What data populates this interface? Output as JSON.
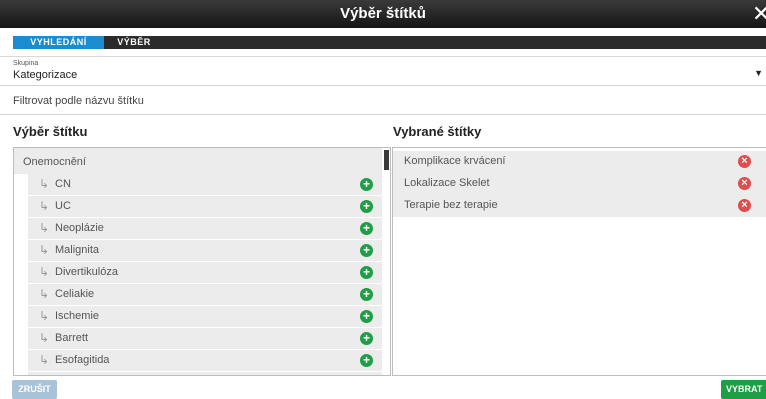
{
  "dialog": {
    "title": "Výběr štítků",
    "close_icon": "close-icon"
  },
  "tabs": [
    {
      "label": "VYHLEDÁNÍ",
      "active": true
    },
    {
      "label": "VÝBĚR",
      "active": false
    }
  ],
  "group": {
    "label": "Skupina",
    "value": "Kategorizace"
  },
  "filter": {
    "placeholder": "Filtrovat podle názvu štítku",
    "value": ""
  },
  "left": {
    "heading": "Výběr štítku",
    "parent": "Onemocnění",
    "children": [
      {
        "label": "CN"
      },
      {
        "label": "UC"
      },
      {
        "label": "Neoplázie"
      },
      {
        "label": "Malignita"
      },
      {
        "label": "Divertikulóza"
      },
      {
        "label": "Celiakie"
      },
      {
        "label": "Ischemie"
      },
      {
        "label": "Barrett"
      },
      {
        "label": "Esofagitida"
      },
      {
        "label": ""
      }
    ]
  },
  "right": {
    "heading": "Vybrané štítky",
    "selected": [
      {
        "label": "Komplikace krvácení"
      },
      {
        "label": "Lokalizace Skelet"
      },
      {
        "label": "Terapie bez terapie"
      }
    ]
  },
  "buttons": {
    "cancel": "ZRUŠIT",
    "select": "VYBRAT"
  },
  "colors": {
    "tab_active": "#1b8ccd",
    "add": "#1e9e45",
    "remove": "#e14c4c",
    "select_button": "#1e9e45",
    "cancel_button": "#a8c3d8"
  }
}
